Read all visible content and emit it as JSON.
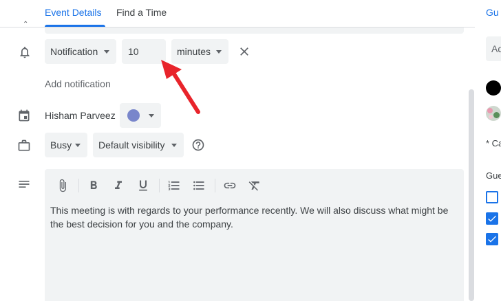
{
  "tabs": [
    {
      "label": "Event Details",
      "active": true
    },
    {
      "label": "Find a Time",
      "active": false
    }
  ],
  "notification": {
    "type_value": "Notification",
    "amount_value": "10",
    "unit_value": "minutes",
    "add_link": "Add notification"
  },
  "calendar": {
    "owner": "Hisham Parveez",
    "color": "#7986cb"
  },
  "availability": {
    "status_value": "Busy",
    "visibility_value": "Default visibility"
  },
  "description": {
    "text": "This meeting is with regards to your performance recently. We will also discuss what might be the best decision for you and the company."
  },
  "right_panel": {
    "title": "Gu",
    "input_text": "Ad",
    "small_text": "* Ca",
    "guest_label": "Gue"
  },
  "colors": {
    "accent": "#1a73e8",
    "field_bg": "#f1f3f4",
    "arrow": "#e8242b"
  }
}
